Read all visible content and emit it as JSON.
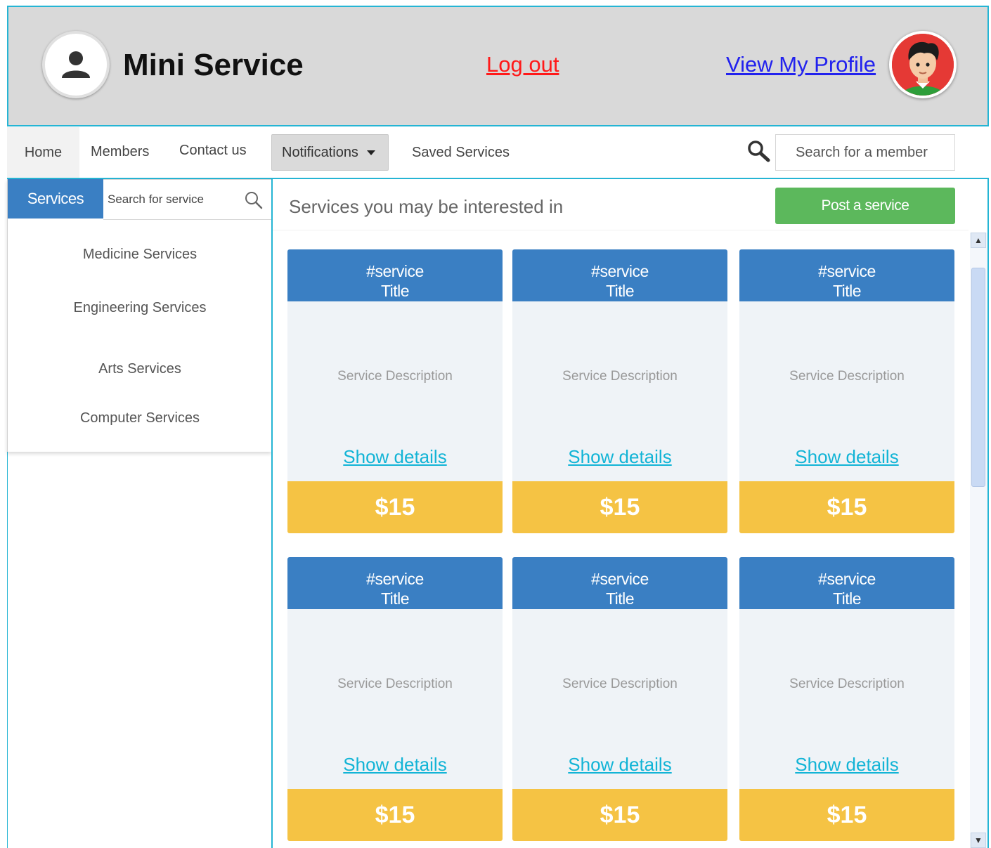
{
  "header": {
    "app_title": "Mini Service",
    "logout_label": "Log out",
    "profile_label": "View My Profile"
  },
  "nav": {
    "home": "Home",
    "members": "Members",
    "contact": "Contact us",
    "notifications": "Notifications",
    "saved": "Saved Services",
    "member_search_placeholder": "Search for a member"
  },
  "sidebar": {
    "services_tab": "Services",
    "search_placeholder": "Search for service",
    "categories": [
      {
        "label": "Medicine Services"
      },
      {
        "label": "Engineering Services"
      },
      {
        "label": "Arts Services"
      },
      {
        "label": "Computer Services"
      }
    ]
  },
  "main": {
    "title": "Services you may be interested in",
    "post_button": "Post a service",
    "cards": [
      {
        "title_line1": "#service",
        "title_line2": "Title",
        "description": "Service Description",
        "details_label": "Show details",
        "price": "$15"
      },
      {
        "title_line1": "#service",
        "title_line2": "Title",
        "description": "Service Description",
        "details_label": "Show details",
        "price": "$15"
      },
      {
        "title_line1": "#service",
        "title_line2": "Title",
        "description": "Service Description",
        "details_label": "Show details",
        "price": "$15"
      }
    ],
    "cards_row2": [
      {
        "title_line1": "#service",
        "title_line2": "Title",
        "description": "Service Description",
        "details_label": "Show details",
        "price": "$15"
      },
      {
        "title_line1": "#service",
        "title_line2": "Title",
        "description": "Service Description",
        "details_label": "Show details",
        "price": "$15"
      },
      {
        "title_line1": "#service",
        "title_line2": "Title",
        "description": "Service Description",
        "details_label": "Show details",
        "price": "$15"
      }
    ]
  },
  "colors": {
    "accent_blue": "#3a7fc3",
    "frame_cyan": "#25b5d4",
    "post_green": "#5cb85c",
    "price_yellow": "#f5c344",
    "logout_red": "#ff1a1a",
    "profile_blue": "#2222ee"
  },
  "icons": {
    "logo": "user-icon",
    "avatar": "user-avatar",
    "member_search": "search-icon",
    "service_search": "search-icon",
    "notifications_caret": "caret-down-icon"
  }
}
